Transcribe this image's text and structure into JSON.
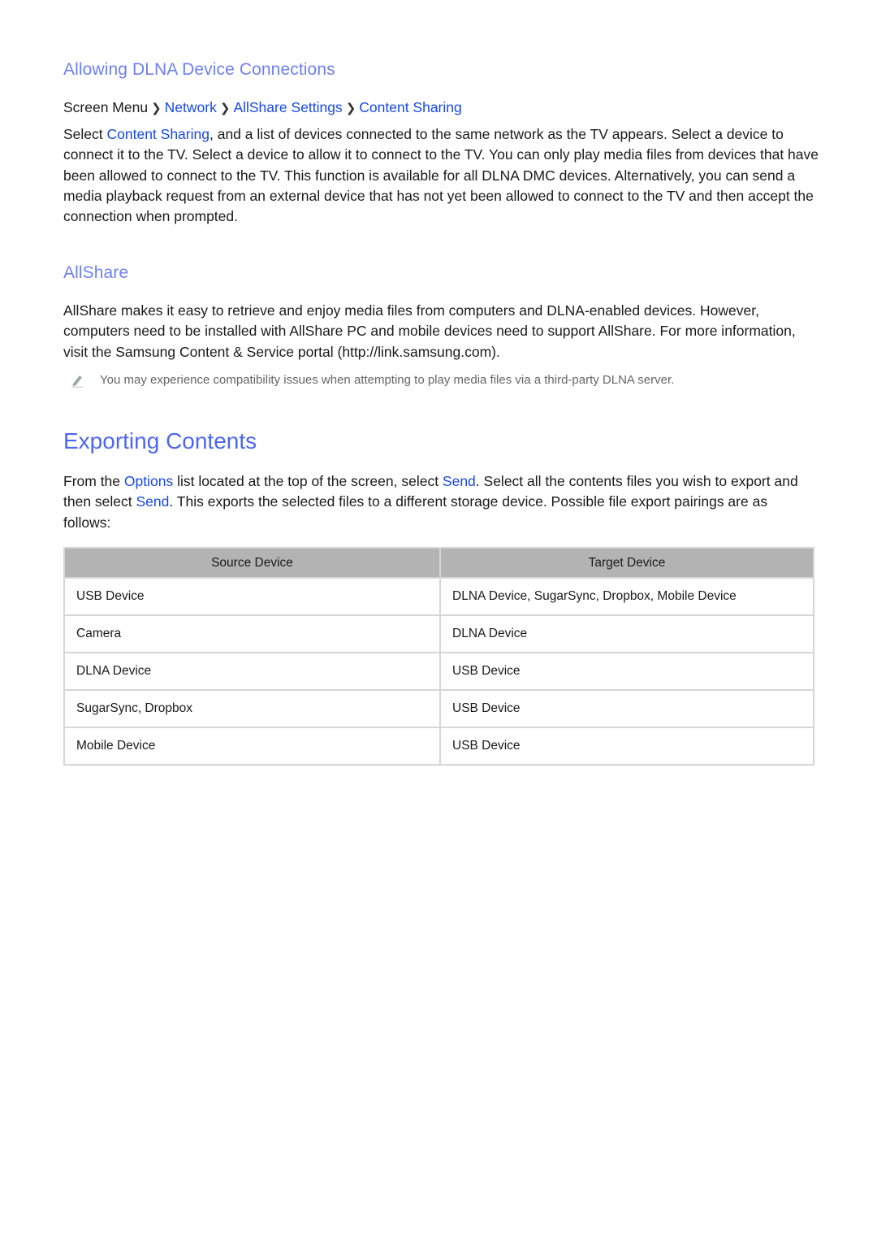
{
  "section1": {
    "heading": "Allowing DLNA Device Connections",
    "breadcrumb": {
      "root": "Screen Menu",
      "items": [
        "Network",
        "AllShare Settings",
        "Content Sharing"
      ]
    },
    "paragraph": {
      "prefix": "Select ",
      "link": "Content Sharing",
      "rest": ", and a list of devices connected to the same network as the TV appears. Select a device to connect it to the TV. Select a device to allow it to connect to the TV. You can only play media files from devices that have been allowed to connect to the TV. This function is available for all DLNA DMC devices. Alternatively, you can send a media playback request from an external device that has not yet been allowed to connect to the TV and then accept the connection when prompted."
    }
  },
  "section2": {
    "heading": "AllShare",
    "paragraph": "AllShare makes it easy to retrieve and enjoy media files from computers and DLNA-enabled devices. However, computers need to be installed with AllShare PC and mobile devices need to support AllShare. For more information, visit the Samsung Content & Service portal (http://link.samsung.com).",
    "note": {
      "icon": "pencil-icon",
      "text": "You may experience compatibility issues when attempting to play media files via a third-party DLNA server."
    }
  },
  "section3": {
    "heading": "Exporting Contents",
    "paragraph": {
      "p1": "From the ",
      "link1": "Options",
      "p2": " list located at the top of the screen, select ",
      "link2": "Send",
      "p3": ". Select all the contents files you wish to export and then select ",
      "link3": "Send",
      "p4": ". This exports the selected files to a different storage device. Possible file export pairings are as follows:"
    },
    "table": {
      "headers": [
        "Source Device",
        "Target Device"
      ],
      "rows": [
        [
          "USB Device",
          "DLNA Device, SugarSync, Dropbox, Mobile Device"
        ],
        [
          "Camera",
          "DLNA Device"
        ],
        [
          "DLNA Device",
          "USB Device"
        ],
        [
          "SugarSync, Dropbox",
          "USB Device"
        ],
        [
          "Mobile Device",
          "USB Device"
        ]
      ]
    }
  },
  "colors": {
    "subheading": "#6e80f5",
    "heading": "#4d66f2",
    "link": "#1649e6",
    "table_header_bg": "#b3b3b3",
    "table_border": "#d6d6d6"
  }
}
